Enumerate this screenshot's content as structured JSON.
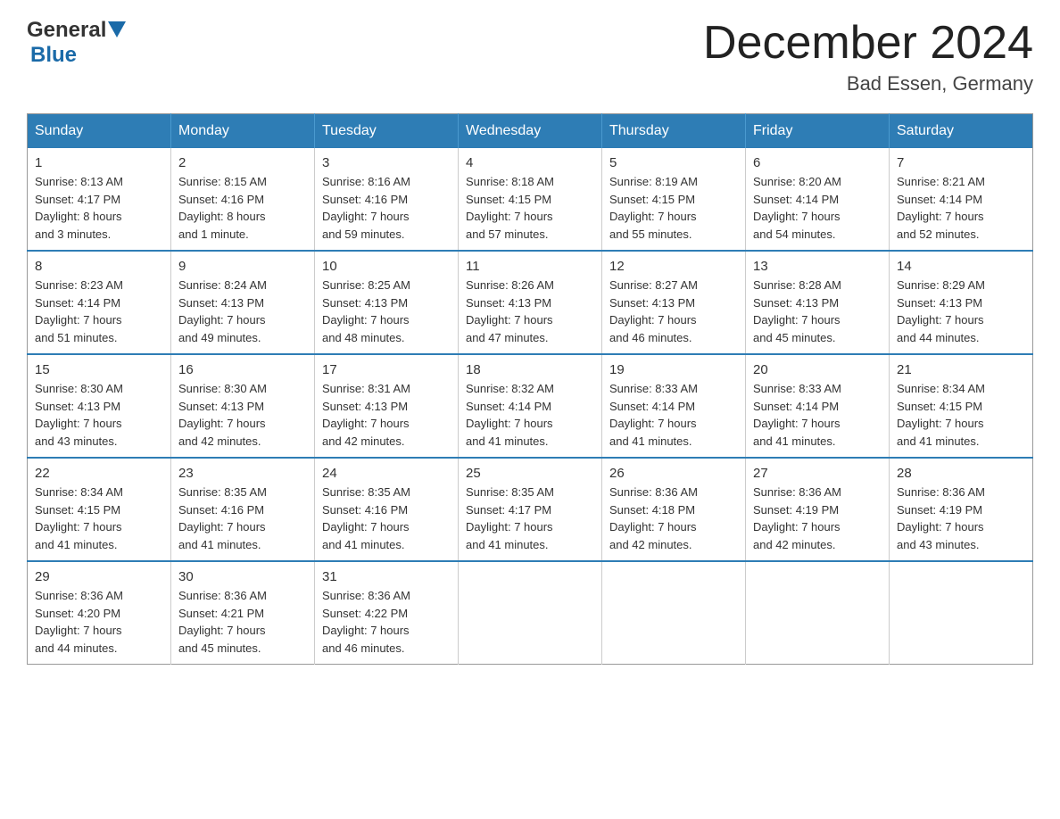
{
  "header": {
    "title": "December 2024",
    "subtitle": "Bad Essen, Germany",
    "logo_general": "General",
    "logo_blue": "Blue"
  },
  "columns": [
    "Sunday",
    "Monday",
    "Tuesday",
    "Wednesday",
    "Thursday",
    "Friday",
    "Saturday"
  ],
  "weeks": [
    [
      {
        "day": "1",
        "sunrise": "8:13 AM",
        "sunset": "4:17 PM",
        "daylight": "8 hours and 3 minutes."
      },
      {
        "day": "2",
        "sunrise": "8:15 AM",
        "sunset": "4:16 PM",
        "daylight": "8 hours and 1 minute."
      },
      {
        "day": "3",
        "sunrise": "8:16 AM",
        "sunset": "4:16 PM",
        "daylight": "7 hours and 59 minutes."
      },
      {
        "day": "4",
        "sunrise": "8:18 AM",
        "sunset": "4:15 PM",
        "daylight": "7 hours and 57 minutes."
      },
      {
        "day": "5",
        "sunrise": "8:19 AM",
        "sunset": "4:15 PM",
        "daylight": "7 hours and 55 minutes."
      },
      {
        "day": "6",
        "sunrise": "8:20 AM",
        "sunset": "4:14 PM",
        "daylight": "7 hours and 54 minutes."
      },
      {
        "day": "7",
        "sunrise": "8:21 AM",
        "sunset": "4:14 PM",
        "daylight": "7 hours and 52 minutes."
      }
    ],
    [
      {
        "day": "8",
        "sunrise": "8:23 AM",
        "sunset": "4:14 PM",
        "daylight": "7 hours and 51 minutes."
      },
      {
        "day": "9",
        "sunrise": "8:24 AM",
        "sunset": "4:13 PM",
        "daylight": "7 hours and 49 minutes."
      },
      {
        "day": "10",
        "sunrise": "8:25 AM",
        "sunset": "4:13 PM",
        "daylight": "7 hours and 48 minutes."
      },
      {
        "day": "11",
        "sunrise": "8:26 AM",
        "sunset": "4:13 PM",
        "daylight": "7 hours and 47 minutes."
      },
      {
        "day": "12",
        "sunrise": "8:27 AM",
        "sunset": "4:13 PM",
        "daylight": "7 hours and 46 minutes."
      },
      {
        "day": "13",
        "sunrise": "8:28 AM",
        "sunset": "4:13 PM",
        "daylight": "7 hours and 45 minutes."
      },
      {
        "day": "14",
        "sunrise": "8:29 AM",
        "sunset": "4:13 PM",
        "daylight": "7 hours and 44 minutes."
      }
    ],
    [
      {
        "day": "15",
        "sunrise": "8:30 AM",
        "sunset": "4:13 PM",
        "daylight": "7 hours and 43 minutes."
      },
      {
        "day": "16",
        "sunrise": "8:30 AM",
        "sunset": "4:13 PM",
        "daylight": "7 hours and 42 minutes."
      },
      {
        "day": "17",
        "sunrise": "8:31 AM",
        "sunset": "4:13 PM",
        "daylight": "7 hours and 42 minutes."
      },
      {
        "day": "18",
        "sunrise": "8:32 AM",
        "sunset": "4:14 PM",
        "daylight": "7 hours and 41 minutes."
      },
      {
        "day": "19",
        "sunrise": "8:33 AM",
        "sunset": "4:14 PM",
        "daylight": "7 hours and 41 minutes."
      },
      {
        "day": "20",
        "sunrise": "8:33 AM",
        "sunset": "4:14 PM",
        "daylight": "7 hours and 41 minutes."
      },
      {
        "day": "21",
        "sunrise": "8:34 AM",
        "sunset": "4:15 PM",
        "daylight": "7 hours and 41 minutes."
      }
    ],
    [
      {
        "day": "22",
        "sunrise": "8:34 AM",
        "sunset": "4:15 PM",
        "daylight": "7 hours and 41 minutes."
      },
      {
        "day": "23",
        "sunrise": "8:35 AM",
        "sunset": "4:16 PM",
        "daylight": "7 hours and 41 minutes."
      },
      {
        "day": "24",
        "sunrise": "8:35 AM",
        "sunset": "4:16 PM",
        "daylight": "7 hours and 41 minutes."
      },
      {
        "day": "25",
        "sunrise": "8:35 AM",
        "sunset": "4:17 PM",
        "daylight": "7 hours and 41 minutes."
      },
      {
        "day": "26",
        "sunrise": "8:36 AM",
        "sunset": "4:18 PM",
        "daylight": "7 hours and 42 minutes."
      },
      {
        "day": "27",
        "sunrise": "8:36 AM",
        "sunset": "4:19 PM",
        "daylight": "7 hours and 42 minutes."
      },
      {
        "day": "28",
        "sunrise": "8:36 AM",
        "sunset": "4:19 PM",
        "daylight": "7 hours and 43 minutes."
      }
    ],
    [
      {
        "day": "29",
        "sunrise": "8:36 AM",
        "sunset": "4:20 PM",
        "daylight": "7 hours and 44 minutes."
      },
      {
        "day": "30",
        "sunrise": "8:36 AM",
        "sunset": "4:21 PM",
        "daylight": "7 hours and 45 minutes."
      },
      {
        "day": "31",
        "sunrise": "8:36 AM",
        "sunset": "4:22 PM",
        "daylight": "7 hours and 46 minutes."
      },
      null,
      null,
      null,
      null
    ]
  ],
  "labels": {
    "sunrise": "Sunrise:",
    "sunset": "Sunset:",
    "daylight": "Daylight:"
  }
}
